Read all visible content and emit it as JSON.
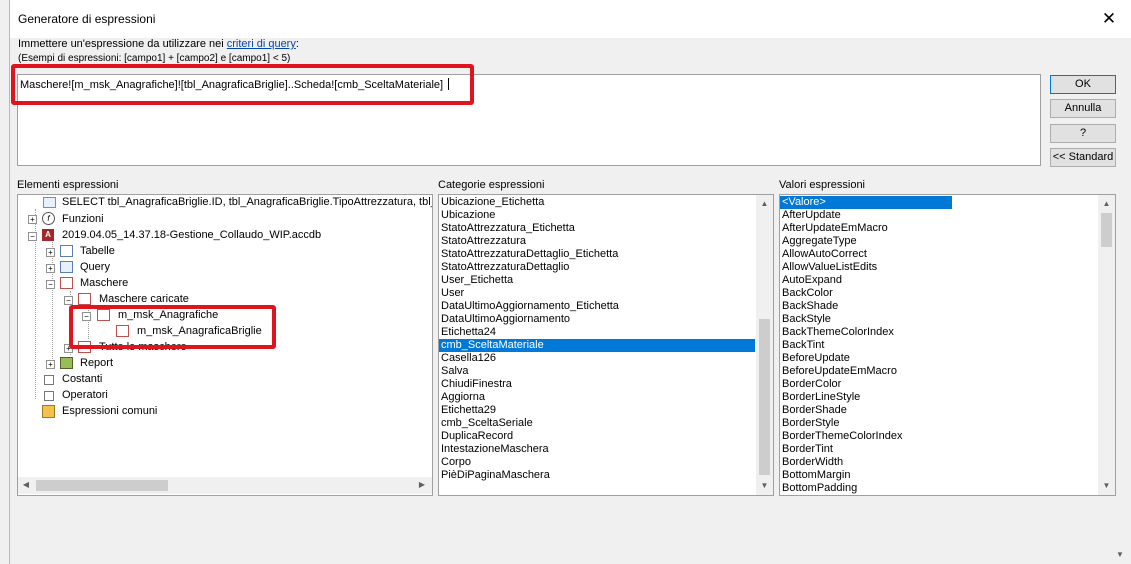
{
  "window": {
    "title": "Generatore di espressioni",
    "close_glyph": "✕"
  },
  "instructions": {
    "prefix": "Immettere un'espressione da utilizzare nei ",
    "link": "criteri di query",
    "suffix": ":"
  },
  "examples": "(Esempi di espressioni: [campo1] + [campo2] e [campo1] < 5)",
  "expression": "Maschere![m_msk_Anagrafiche]![tbl_AnagraficaBriglie]..Scheda![cmb_SceltaMateriale]",
  "buttons": {
    "ok": "OK",
    "cancel": "Annulla",
    "help": "?",
    "standard": "<< Standard"
  },
  "labels": {
    "elements": "Elementi espressioni",
    "categories": "Categorie espressioni",
    "values": "Valori espressioni"
  },
  "tree": {
    "select_item": "SELECT tbl_AnagraficaBriglie.ID, tbl_AnagraficaBriglie.TipoAttrezzatura, tbl_A",
    "functions": "Funzioni",
    "db": "2019.04.05_14.37.18-Gestione_Collaudo_WIP.accdb",
    "tables": "Tabelle",
    "queries": "Query",
    "forms": "Maschere",
    "loaded_forms": "Maschere caricate",
    "form_anagrafiche": "m_msk_Anagrafiche",
    "form_briglie": "m_msk_AnagraficaBriglie",
    "all_forms": "Tutte le maschere",
    "reports": "Report",
    "constants": "Costanti",
    "operators": "Operatori",
    "common": "Espressioni comuni"
  },
  "categories": [
    "Ubicazione_Etichetta",
    "Ubicazione",
    "StatoAttrezzatura_Etichetta",
    "StatoAttrezzatura",
    "StatoAttrezzaturaDettaglio_Etichetta",
    "StatoAttrezzaturaDettaglio",
    "User_Etichetta",
    "User",
    "DataUltimoAggiornamento_Etichetta",
    "DataUltimoAggiornamento",
    "Etichetta24",
    "cmb_SceltaMateriale",
    "Casella126",
    "Salva",
    "ChiudiFinestra",
    "Aggiorna",
    "Etichetta29",
    "cmb_SceltaSeriale",
    "DuplicaRecord",
    "IntestazioneMaschera",
    "Corpo",
    "PièDiPaginaMaschera"
  ],
  "categories_selected": 11,
  "values": [
    "<Valore>",
    "AfterUpdate",
    "AfterUpdateEmMacro",
    "AggregateType",
    "AllowAutoCorrect",
    "AllowValueListEdits",
    "AutoExpand",
    "BackColor",
    "BackShade",
    "BackStyle",
    "BackThemeColorIndex",
    "BackTint",
    "BeforeUpdate",
    "BeforeUpdateEmMacro",
    "BorderColor",
    "BorderLineStyle",
    "BorderShade",
    "BorderStyle",
    "BorderThemeColorIndex",
    "BorderTint",
    "BorderWidth",
    "BottomMargin",
    "BottomPadding"
  ],
  "values_selected": 0,
  "colors": {
    "selection": "#0078d7",
    "highlight": "#e0141e",
    "link": "#0645ad"
  }
}
